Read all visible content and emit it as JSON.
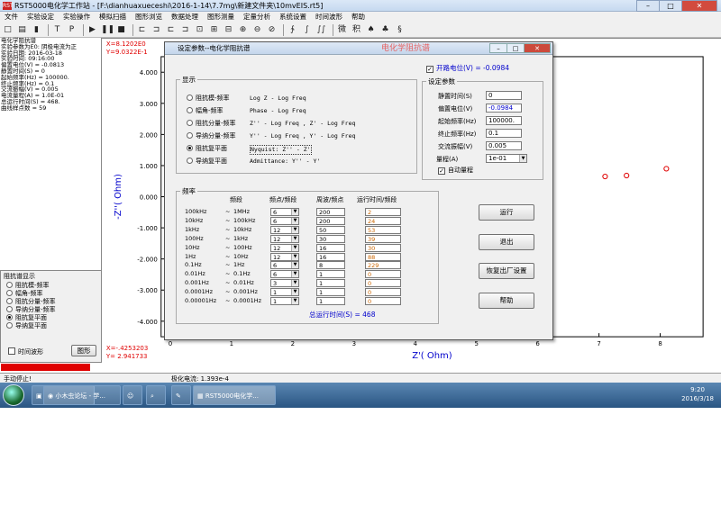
{
  "window": {
    "title": "RST5000电化学工作站 - [F:\\dianhuaxueceshi\\2016-1-14\\7.7mg\\新建文件夹\\10mvEIS.rt5]",
    "icon": "RST",
    "min": "–",
    "max": "□",
    "close": "✕"
  },
  "menu": [
    "文件",
    "实验设定",
    "实验操作",
    "模拟扫描",
    "图形浏览",
    "数据处理",
    "图形测量",
    "定量分析",
    "系统设置",
    "时间波形",
    "帮助"
  ],
  "toolbar": [
    "□",
    "▤",
    "▮",
    "│",
    "T",
    "P",
    "│",
    "▶",
    "❚❚",
    "■",
    "│",
    "⊏",
    "⊐",
    "⊏",
    "⊐",
    "⊡",
    "⊞",
    "⊟",
    "⊕",
    "⊖",
    "⊘",
    "│",
    "∱",
    "∫",
    "∫∫",
    "│",
    "微",
    "积",
    "♠",
    "♣",
    "§"
  ],
  "left_info": [
    "电化学阻抗谱",
    "实验参数为E0: 阴极电流为正",
    "实验日期: 2016-03-18",
    "实验时间: 09:16:00",
    "偏置电位(V) = -0.0813",
    "静置时间(S) = 0",
    "起始频率(Hz) = 100000.",
    "终止频率(Hz) = 0.1",
    "交流振幅(V) = 0.005",
    "电流量程(A) = 1.0E-01",
    "总运行时间(S) = 468.",
    "曲线样点数 = 59"
  ],
  "impedance_display": {
    "title": "阻抗谱显示",
    "options": [
      "阻抗模-频率",
      "幅角-频率",
      "阻抗分量-频率",
      "导纳分量-频率",
      "阻抗复平面",
      "导纳复平面"
    ],
    "selected": 4,
    "time_wave_label": "时间波形",
    "figure_button": "图形"
  },
  "plot": {
    "cursor_top": "X=8.1202E0\nY=9.0322E-1",
    "cursor_bottom": "X=-.4253203\nY= 2.941733",
    "y_title": "-Z''( Ohm)",
    "x_title": "Z'( Ohm)",
    "y_ticks": [
      "4.000",
      "3.000",
      "2.000",
      "1.000",
      "0.000",
      "-1.000",
      "-2.000",
      "-3.000",
      "-4.000"
    ],
    "x_ticks": [
      "0",
      "1",
      "2",
      "3",
      "4",
      "5",
      "6",
      "7",
      "8"
    ]
  },
  "chart_data": {
    "type": "scatter",
    "x": [
      7.1,
      7.45,
      8.1
    ],
    "y": [
      0.65,
      0.68,
      0.9
    ],
    "xlabel": "Z'( Ohm)",
    "ylabel": "-Z''( Ohm)",
    "xlim": [
      -0.15,
      8.7
    ],
    "ylim": [
      -4.5,
      4.5
    ],
    "marker_color": "#e00000"
  },
  "status": {
    "left": "手动停止!",
    "mid": "极化电流: 1.393e-4"
  },
  "taskbar": {
    "tasks": [
      "小木虫论坛 - 学...",
      "RST5000电化学..."
    ],
    "time": "9:20",
    "date": "2016/3/18"
  },
  "dialog": {
    "title": "设定参数--电化学阻抗谱",
    "watermark": "电化学阻抗谱",
    "open_potential_label": "开路电位(V) = -0.0984",
    "display_group": "显示",
    "display_options": [
      {
        "name": "阻抗模-频率",
        "formula": "Log Z - Log Freq"
      },
      {
        "name": "幅角-频率",
        "formula": "Phase - Log Freq"
      },
      {
        "name": "阻抗分量-频率",
        "formula": "Z'' - Log Freq , Z' - Log Freq"
      },
      {
        "name": "导纳分量-频率",
        "formula": "Y'' - Log Freq , Y' - Log Freq"
      },
      {
        "name": "阻抗复平面",
        "formula": "Nyquist:    Z'' - Z'"
      },
      {
        "name": "导纳复平面",
        "formula": "Admittance: Y'' - Y'"
      }
    ],
    "display_selected": 4,
    "settings_group": "设定参数",
    "settings": [
      {
        "label": "静置时间(S)",
        "value": "0"
      },
      {
        "label": "偏置电位(V)",
        "value": "-0.0984"
      },
      {
        "label": "起始频率(Hz)",
        "value": "100000."
      },
      {
        "label": "终止频率(Hz)",
        "value": "0.1"
      },
      {
        "label": "交流振幅(V)",
        "value": "0.005"
      }
    ],
    "range_label": "量程(A)",
    "range_value": "1e-01",
    "auto_range_label": "自动量程",
    "freq_group": "频率",
    "freq_headers": [
      "频段",
      "频点/频段",
      "周波/频点",
      "运行时间/频段"
    ],
    "freq_rows": [
      {
        "from": "100kHz",
        "to": "1MHz",
        "points": "6",
        "cycles": "200",
        "time": "2"
      },
      {
        "from": "10kHz",
        "to": "100kHz",
        "points": "6",
        "cycles": "200",
        "time": "24"
      },
      {
        "from": "1kHz",
        "to": "10kHz",
        "points": "12",
        "cycles": "50",
        "time": "53"
      },
      {
        "from": "100Hz",
        "to": "1kHz",
        "points": "12",
        "cycles": "30",
        "time": "39"
      },
      {
        "from": "10Hz",
        "to": "100Hz",
        "points": "12",
        "cycles": "16",
        "time": "30"
      },
      {
        "from": "1Hz",
        "to": "10Hz",
        "points": "12",
        "cycles": "16",
        "time": "88"
      },
      {
        "from": "0.1Hz",
        "to": "1Hz",
        "points": "6",
        "cycles": "8",
        "time": "229"
      },
      {
        "from": "0.01Hz",
        "to": "0.1Hz",
        "points": "6",
        "cycles": "1",
        "time": "0"
      },
      {
        "from": "0.001Hz",
        "to": "0.01Hz",
        "points": "3",
        "cycles": "1",
        "time": "0"
      },
      {
        "from": "0.0001Hz",
        "to": "0.001Hz",
        "points": "1",
        "cycles": "1",
        "time": "0"
      },
      {
        "from": "0.00001Hz",
        "to": "0.0001Hz",
        "points": "1",
        "cycles": "1",
        "time": "0"
      }
    ],
    "total_time": "总运行时间(S) = 468",
    "buttons": {
      "run": "运行",
      "exit": "退出",
      "restore": "恢复出厂设置",
      "help": "帮助"
    }
  }
}
